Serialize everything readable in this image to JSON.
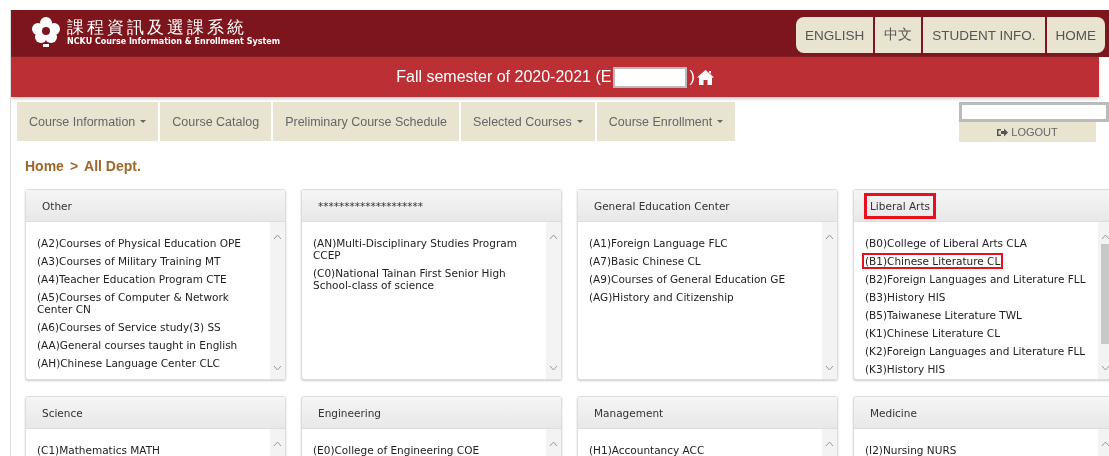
{
  "header": {
    "title": "課程資訊及選課系統",
    "subtitle": "NCKU Course Information & Enrollment System",
    "buttons": [
      "ENGLISH",
      "中文",
      "STUDENT INFO.",
      "HOME"
    ]
  },
  "semester_bar": {
    "text": "Fall semester of 2020-2021 (E",
    "closing": ")"
  },
  "nav": [
    {
      "label": "Course Information",
      "dropdown": true
    },
    {
      "label": "Course Catalog",
      "dropdown": false
    },
    {
      "label": "Preliminary Course Schedule",
      "dropdown": false
    },
    {
      "label": "Selected Courses",
      "dropdown": true
    },
    {
      "label": "Course Enrollment",
      "dropdown": true
    }
  ],
  "logout": {
    "label": "LOGOUT"
  },
  "breadcrumb": [
    {
      "label": "Home"
    },
    {
      "label": "All Dept."
    }
  ],
  "breadcrumb_separator": ">",
  "panels": [
    {
      "title": "Other",
      "highlighted": false,
      "items": [
        {
          "label": "(A2)Courses of Physical Education OPE",
          "highlighted": false
        },
        {
          "label": "(A3)Courses of Military Training MT",
          "highlighted": false
        },
        {
          "label": "(A4)Teacher Education Program CTE",
          "highlighted": false
        },
        {
          "label": "(A5)Courses of Computer & Network Center CN",
          "highlighted": false
        },
        {
          "label": "(A6)Courses of Service study(3) SS",
          "highlighted": false
        },
        {
          "label": "(AA)General courses taught in English",
          "highlighted": false
        },
        {
          "label": "(AH)Chinese Language Center CLC",
          "highlighted": false
        }
      ]
    },
    {
      "title": "********************",
      "highlighted": false,
      "items": [
        {
          "label": "(AN)Multi-Disciplinary Studies Program CCEP",
          "highlighted": false
        },
        {
          "label": "(C0)National Tainan First Senior High School-class of science",
          "highlighted": false
        }
      ]
    },
    {
      "title": "General Education Center",
      "highlighted": false,
      "items": [
        {
          "label": "(A1)Foreign Language FLC",
          "highlighted": false
        },
        {
          "label": "(A7)Basic Chinese CL",
          "highlighted": false
        },
        {
          "label": "(A9)Courses of General Education GE",
          "highlighted": false
        },
        {
          "label": "(AG)History and Citizenship",
          "highlighted": false
        }
      ]
    },
    {
      "title": "Liberal Arts",
      "highlighted": true,
      "items": [
        {
          "label": "(B0)College of Liberal Arts CLA",
          "highlighted": false
        },
        {
          "label": "(B1)Chinese Literature CL",
          "highlighted": true
        },
        {
          "label": "(B2)Foreign Languages and Literature FLL",
          "highlighted": false
        },
        {
          "label": "(B3)History HIS",
          "highlighted": false
        },
        {
          "label": "(B5)Taiwanese Literature TWL",
          "highlighted": false
        },
        {
          "label": "(K1)Chinese Literature CL",
          "highlighted": false
        },
        {
          "label": "(K2)Foreign Languages and Literature FLL",
          "highlighted": false
        },
        {
          "label": "(K3)History HIS",
          "highlighted": false
        }
      ]
    },
    {
      "title": "Science",
      "highlighted": false,
      "items": [
        {
          "label": "(C1)Mathematics MATH",
          "highlighted": false
        }
      ]
    },
    {
      "title": "Engineering",
      "highlighted": false,
      "items": [
        {
          "label": "(E0)College of Engineering COE",
          "highlighted": false
        }
      ]
    },
    {
      "title": "Management",
      "highlighted": false,
      "items": [
        {
          "label": "(H1)Accountancy ACC",
          "highlighted": false
        }
      ]
    },
    {
      "title": "Medicine",
      "highlighted": false,
      "items": [
        {
          "label": "(I2)Nursing NURS",
          "highlighted": false
        }
      ]
    }
  ]
}
